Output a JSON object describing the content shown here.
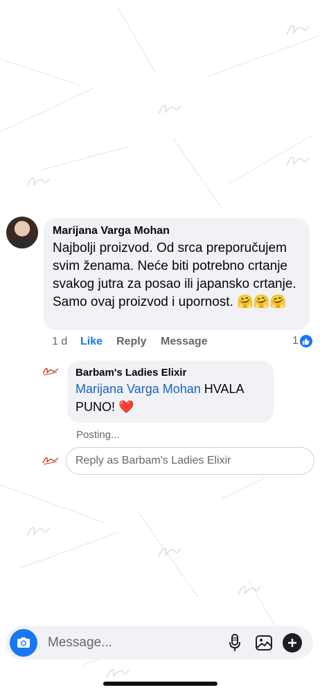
{
  "comment": {
    "author": "Marijana Varga Mohan",
    "text": "Najbolji proizvod. Od srca preporučujem svim ženama. Neće biti potrebno crtanje svakog jutra za posao ili japansko crtanje. Samo ovaj proizvod i upornost. 🤗🤗🤗",
    "time": "1 d",
    "like_label": "Like",
    "reply_label": "Reply",
    "message_label": "Message",
    "reaction_count": "1"
  },
  "reply": {
    "author": "Barbam's Ladies Elixir",
    "mention": "Marijana Varga Mohan",
    "text": " HVALA PUNO! ❤️",
    "status": "Posting..."
  },
  "reply_input": {
    "placeholder": "Reply as Barbam's Ladies Elixir"
  },
  "composer": {
    "placeholder": "Message..."
  },
  "icons": {
    "camera": "camera-icon",
    "mic": "microphone-icon",
    "gallery": "gallery-icon",
    "plus": "plus-icon",
    "like": "thumbs-up-icon"
  },
  "colors": {
    "accent": "#1877f2",
    "bubble": "#f0f2f5",
    "secondary_text": "#65676b"
  }
}
